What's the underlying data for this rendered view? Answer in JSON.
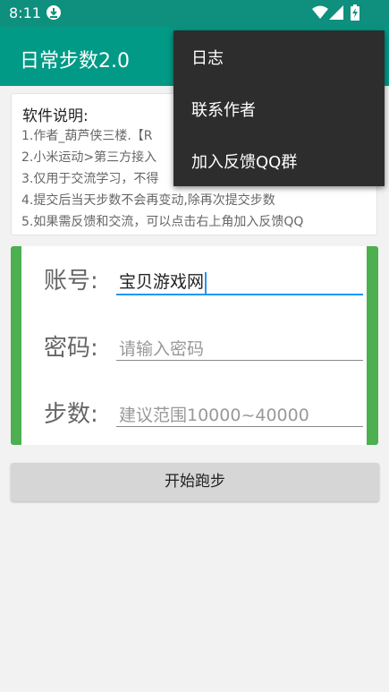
{
  "status_bar": {
    "time": "8:11"
  },
  "app_bar": {
    "title": "日常步数2.0"
  },
  "info": {
    "heading": "软件说明:",
    "lines": [
      "1.作者_葫芦侠三楼.【R",
      "2.小米运动>第三方接入",
      "3.仅用于交流学习，不得",
      "4.提交后当天步数不会再变动,除再次提交步数",
      "5.如果需反馈和交流，可以点击右上角加入反馈QQ"
    ]
  },
  "form": {
    "account_label": "账号:",
    "account_value": "宝贝游戏网",
    "password_label": "密码:",
    "password_placeholder": "请输入密码",
    "steps_label": "步数:",
    "steps_placeholder": "建议范围10000~40000"
  },
  "run_button": "开始跑步",
  "menu": {
    "items": [
      "日志",
      "联系作者",
      "加入反馈QQ群"
    ]
  },
  "colors": {
    "status_bar": "#0f8f7d",
    "app_bar": "#009a86",
    "form_accent": "#4caf50",
    "focus_line": "#2196f3",
    "menu_bg": "#2d2d2d"
  }
}
